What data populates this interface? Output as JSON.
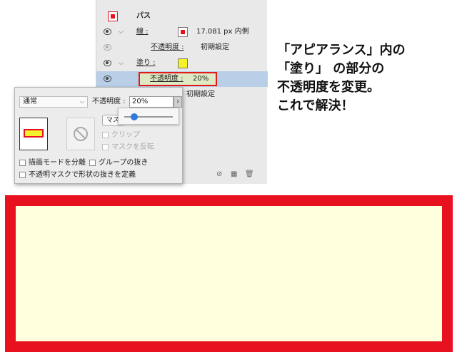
{
  "panel": {
    "path_label": "パス",
    "stroke": {
      "label": "線 :",
      "value": "17.081 px 内側"
    },
    "stroke_opacity": {
      "label": "不透明度 :",
      "value": "初期設定"
    },
    "fill": {
      "label": "塗り :"
    },
    "fill_opacity": {
      "label": "不透明度 :",
      "value": "20%"
    },
    "default_label": "初期設定"
  },
  "transparency": {
    "blend_mode": "通常",
    "opacity_label": "不透明度 :",
    "opacity_value": "20%",
    "opacity_fraction": 0.2,
    "make_mask_label": "マスク作成",
    "clip_label": "クリップ",
    "invert_mask_label": "マスクを反転",
    "isolate_blend_label": "描画モードを分離",
    "knockout_group_label": "グループの抜き",
    "opacity_mask_knockout_label": "不透明マスクで形状の抜きを定義"
  },
  "annotation": {
    "line1": "「アピアランス」内の",
    "line2": "「塗り」 の部分の",
    "line3": "不透明度を変更。",
    "line4": "これで解決！"
  },
  "colors": {
    "stroke": "#e8111f",
    "fill": "#f4f22a",
    "preview_fill": "#fffedd",
    "highlight": "#e21a1a",
    "selection": "#b9cfe8"
  }
}
